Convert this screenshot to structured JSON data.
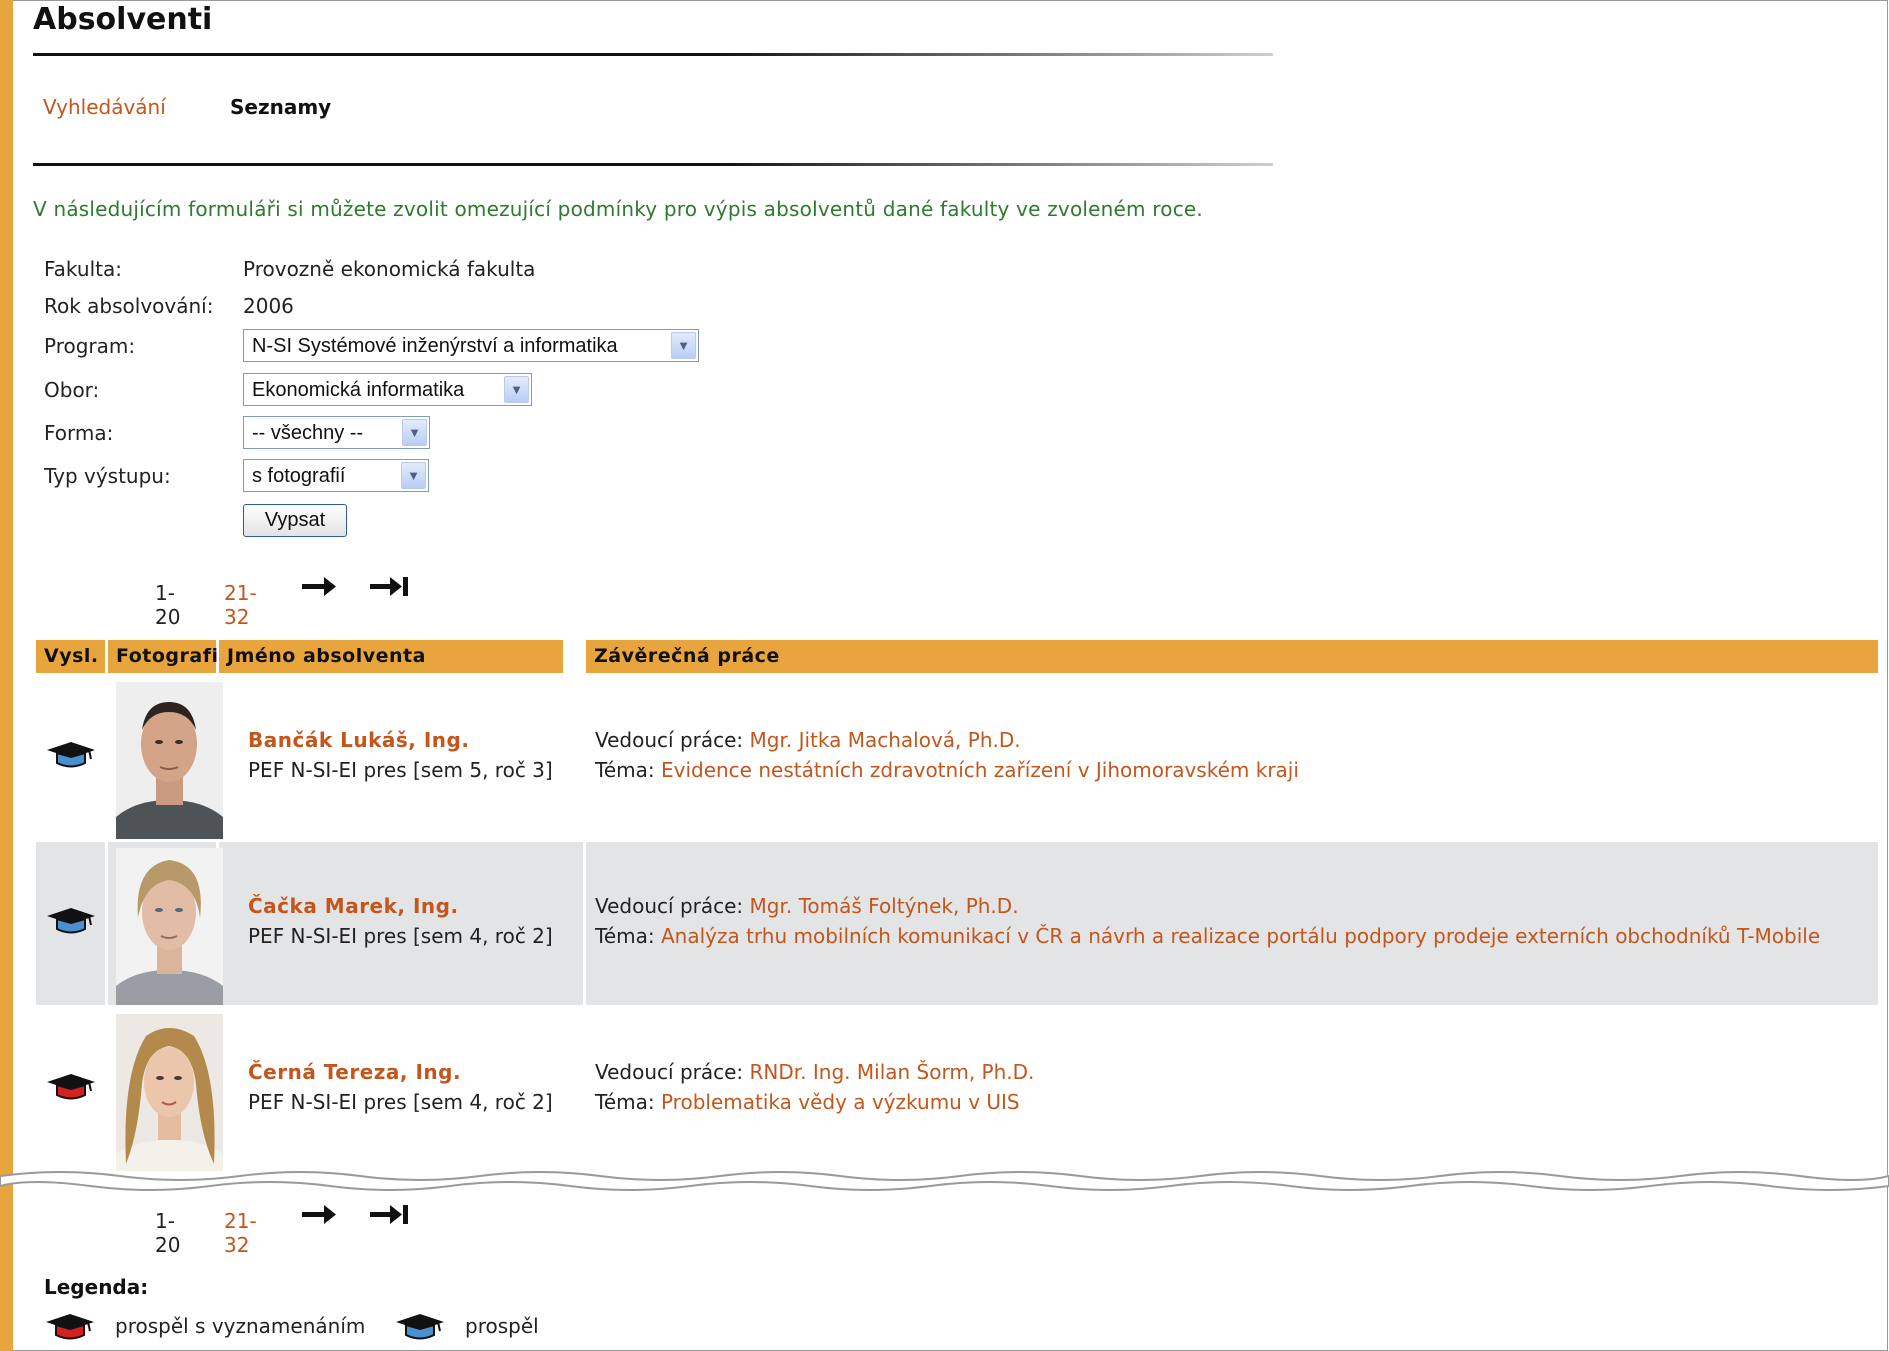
{
  "page": {
    "title": "Absolventi"
  },
  "nav": {
    "search_label": "Vyhledávání",
    "lists_label": "Seznamy"
  },
  "intro": "V následujícím formuláři si můžete zvolit omezující podmínky pro výpis absolventů dané fakulty ve zvoleném roce.",
  "form": {
    "faculty_label": "Fakulta:",
    "faculty_value": "Provozně ekonomická fakulta",
    "year_label": "Rok absolvování:",
    "year_value": "2006",
    "program_label": "Program:",
    "program_value": "N-SI Systémové inženýrství a informatika",
    "field_label": "Obor:",
    "field_value": "Ekonomická informatika",
    "form_label": "Forma:",
    "form_value": "-- všechny --",
    "output_label": "Typ výstupu:",
    "output_value": "s fotografií",
    "submit_label": "Vypsat"
  },
  "pager": {
    "current": "1-20",
    "next_range": "21-32"
  },
  "table": {
    "headers": [
      "Vysl.",
      "Fotografie",
      "Jméno absolventa",
      "Závěrečná práce"
    ],
    "supervisor_label": "Vedoucí práce:",
    "topic_label": "Téma:",
    "rows": [
      {
        "result": "prospěl",
        "name": "Bančák Lukáš, Ing.",
        "study": "PEF N-SI-EI pres [sem 5, roč 3]",
        "supervisor": "Mgr. Jitka Machalová, Ph.D.",
        "topic": "Evidence nestátních zdravotních zařízení v Jihomoravském kraji"
      },
      {
        "result": "prospěl",
        "name": "Čačka Marek, Ing.",
        "study": "PEF N-SI-EI pres [sem 4, roč 2]",
        "supervisor": "Mgr. Tomáš Foltýnek, Ph.D.",
        "topic": "Analýza trhu mobilních komunikací v ČR a návrh a realizace portálu podpory prodeje externích obchodníků T-Mobile"
      },
      {
        "result": "prospěl s vyznamenáním",
        "name": "Černá Tereza, Ing.",
        "study": "PEF N-SI-EI pres [sem 4, roč 2]",
        "supervisor": "RNDr. Ing. Milan Šorm, Ph.D.",
        "topic": "Problematika vědy a výzkumu v UIS"
      }
    ]
  },
  "legend": {
    "title": "Legenda:",
    "honors_label": "prospěl s vyznamenáním",
    "pass_label": "prospěl"
  },
  "colors": {
    "accent": "#e9a53d",
    "link": "#c4561c",
    "intro_text": "#2e7a2e",
    "alt_row": "#e3e4e6",
    "honors_cap": "#d42020",
    "pass_cap": "#4a8fd0"
  },
  "icons": {
    "pass": "graduation-cap-blue-icon",
    "honors": "graduation-cap-red-icon",
    "next": "arrow-right-icon",
    "last": "arrow-last-icon"
  }
}
